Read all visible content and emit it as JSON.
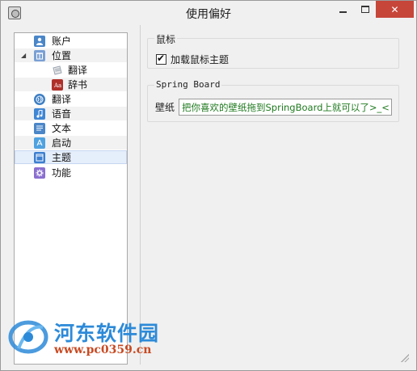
{
  "window": {
    "title": "使用偏好",
    "close_glyph": "✕"
  },
  "sidebar": {
    "items": [
      {
        "label": "账户",
        "icon": "account-icon",
        "color": "#4a86c8"
      },
      {
        "label": "位置",
        "icon": "location-icon",
        "color": "#7aa0d4",
        "expander": "◢"
      },
      {
        "label": "翻译",
        "icon": "translate-sub-icon",
        "color": "#9aa4b0"
      },
      {
        "label": "辞书",
        "icon": "dictionary-icon",
        "color": "#b0302a"
      },
      {
        "label": "翻译",
        "icon": "globe-icon",
        "color": "#3f7fc4"
      },
      {
        "label": "语音",
        "icon": "music-note-icon",
        "color": "#3f86d4"
      },
      {
        "label": "文本",
        "icon": "text-icon",
        "color": "#4a86c8"
      },
      {
        "label": "启动",
        "icon": "appstore-icon",
        "color": "#4fa2e0"
      },
      {
        "label": "主题",
        "icon": "theme-icon",
        "color": "#3b7ed0"
      },
      {
        "label": "功能",
        "icon": "gear-icon",
        "color": "#8a6fd0"
      }
    ]
  },
  "mouse_group": {
    "legend": "鼠标",
    "checkbox_label": "加载鼠标主题",
    "checked": true
  },
  "springboard_group": {
    "legend": "Spring Board",
    "wallpaper_label": "壁纸",
    "wallpaper_value": "把你喜欢的壁纸拖到SpringBoard上就可以了>_<"
  },
  "watermark": {
    "name": "河东软件园",
    "url": "www.pc0359.cn"
  }
}
